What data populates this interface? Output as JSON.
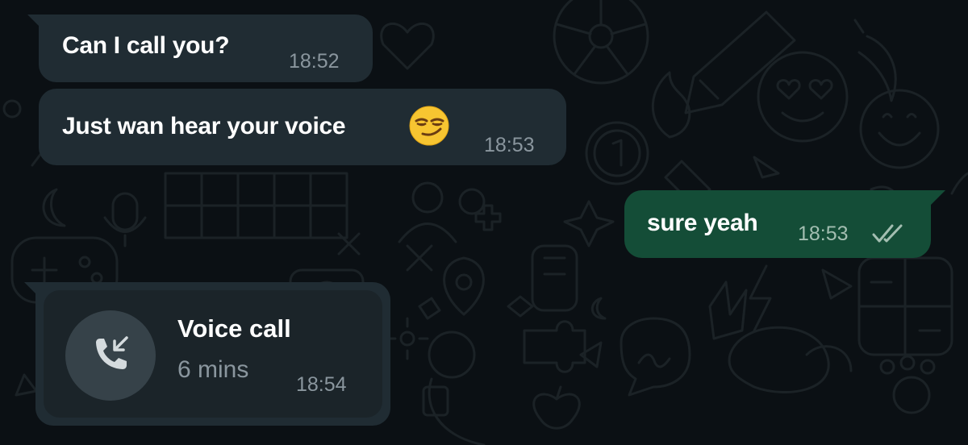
{
  "chat": {
    "messages": [
      {
        "direction": "incoming",
        "text": "Can I call you?",
        "time": "18:52"
      },
      {
        "direction": "incoming",
        "text": "Just wan hear your voice",
        "emoji": "smirking-face",
        "time": "18:53"
      },
      {
        "direction": "outgoing",
        "text": "sure yeah",
        "time": "18:53",
        "status": "read"
      },
      {
        "direction": "incoming",
        "type": "call",
        "call_title": "Voice call",
        "call_duration": "6 mins",
        "call_icon": "incoming-call-icon",
        "time": "18:54"
      }
    ]
  },
  "colors": {
    "background": "#0b1014",
    "incoming_bubble": "#202c33",
    "outgoing_bubble": "#144d37",
    "read_ticks": "#a3beb1"
  }
}
